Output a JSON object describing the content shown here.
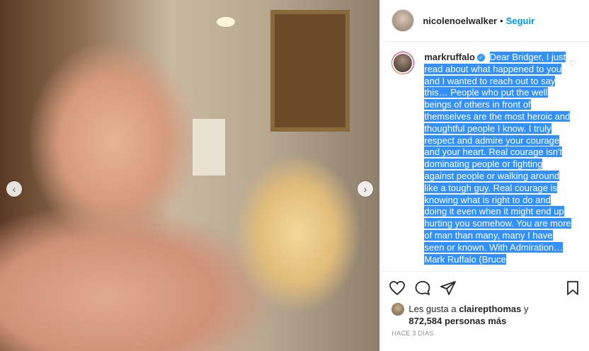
{
  "post": {
    "owner_username": "nicolenoelwalker",
    "separator": "•",
    "follow_label": "Seguir"
  },
  "comment": {
    "username": "markruffalo",
    "verified_icon": "✓",
    "text": "Dear Bridger, I just read about what happened to you and I wanted to reach out to say this… People who put the well beings of others in front of themselves are the most heroic and thoughtful people I know. I truly respect and admire your courage and your heart. Real courage isn't dominating people or fighting against people or walking around like a tough guy. Real courage is knowing what is right to do and doing it even when it might end up hurting you somehow. You are more of man than many, many I have seen or known. With Admiration… Mark Ruffalo (Bruce"
  },
  "likes": {
    "prefix": "Les gusta a",
    "user": "clairepthomas",
    "conjunction": "y",
    "count": "872,584 personas más"
  },
  "timestamp": "HACE 3 DÍAS",
  "icons": {
    "prev": "‹",
    "next": "›",
    "heart": "♡"
  },
  "colors": {
    "link_blue": "#0095f6",
    "selection": "#3391ff"
  }
}
